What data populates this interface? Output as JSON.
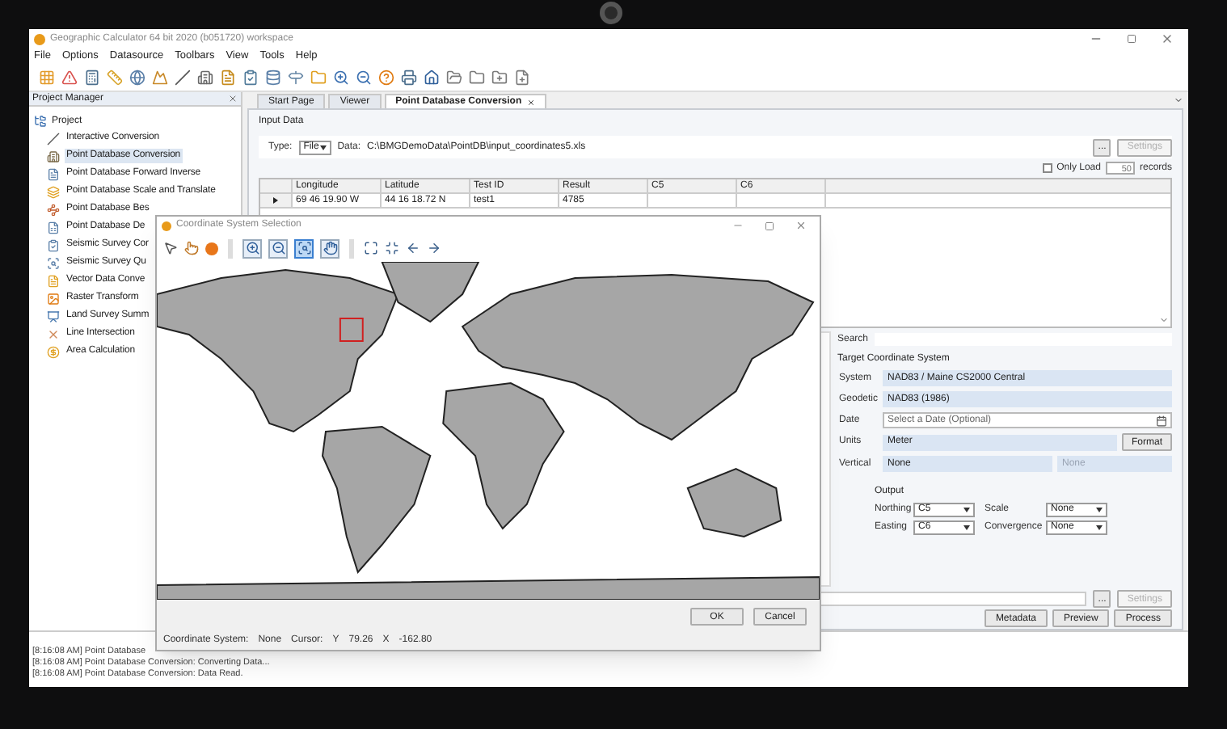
{
  "window": {
    "title": "Geographic Calculator 64 bit 2020 (b051720) workspace"
  },
  "menu": [
    "File",
    "Options",
    "Datasource",
    "Toolbars",
    "View",
    "Tools",
    "Help"
  ],
  "project_manager": {
    "title": "Project Manager",
    "root": {
      "label": "Project",
      "expanded": true,
      "children": [
        {
          "label": "Interactive Conversion",
          "selected": false
        },
        {
          "label": "Point Database Conversion",
          "selected": true
        },
        {
          "label": "Point Database Forward Inverse",
          "selected": false
        },
        {
          "label": "Point Database Scale and Translate",
          "selected": false
        },
        {
          "label": "Point Database Bes",
          "selected": false
        },
        {
          "label": "Point Database De",
          "selected": false
        },
        {
          "label": "Seismic Survey Cor",
          "selected": false
        },
        {
          "label": "Seismic Survey Qu",
          "selected": false
        },
        {
          "label": "Vector Data Conve",
          "selected": false
        },
        {
          "label": "Raster Transform",
          "selected": false
        },
        {
          "label": "Land Survey Summ",
          "selected": false
        },
        {
          "label": "Line Intersection",
          "selected": false
        },
        {
          "label": "Area Calculation",
          "selected": false
        }
      ]
    }
  },
  "tabs": [
    {
      "label": "Start Page",
      "selected": false,
      "closable": false
    },
    {
      "label": "Viewer",
      "selected": false,
      "closable": false
    },
    {
      "label": "Point Database Conversion",
      "selected": true,
      "closable": true
    }
  ],
  "input_data": {
    "title": "Input Data",
    "type_label": "Type:",
    "type_value": "File",
    "data_label": "Data:",
    "data_value": "C:\\BMGDemoData\\PointDB\\input_coordinates5.xls",
    "browse": "...",
    "settings": {
      "label": "Settings",
      "disabled": true
    },
    "only_load": {
      "label": "Only Load",
      "checked": false
    },
    "records_value": "50",
    "records_label": "records"
  },
  "table": {
    "columns": [
      "Longitude",
      "Latitude",
      "Test ID",
      "Result",
      "C5",
      "C6"
    ],
    "rows": [
      {
        "selected": true,
        "cells": [
          "69 46 19.90 W",
          "44 16 18.72 N",
          "test1",
          "4785",
          "",
          ""
        ]
      }
    ]
  },
  "search": {
    "label": "Search"
  },
  "target": {
    "title": "Target Coordinate System",
    "system_label": "System",
    "system": "NAD83 / Maine CS2000 Central",
    "geodetic_label": "Geodetic",
    "geodetic": "NAD83 (1986)",
    "date_label": "Date",
    "date_placeholder": "Select a Date (Optional)",
    "units_label": "Units",
    "units": "Meter",
    "format": "Format",
    "vertical_label": "Vertical",
    "vertical": "None",
    "vertical_2": {
      "value": "None",
      "disabled": true
    }
  },
  "output": {
    "title": "Output",
    "northing_label": "Northing",
    "northing": "C5",
    "easting_label": "Easting",
    "easting": "C6",
    "scale_label": "Scale",
    "scale": "None",
    "convergence_label": "Convergence",
    "convergence": "None"
  },
  "output_file": {
    "browse": "...",
    "settings": {
      "label": "Settings",
      "disabled": true
    }
  },
  "actions": [
    "Metadata",
    "Preview",
    "Process"
  ],
  "log": [
    "[8:16:08 AM] Point Database",
    "[8:16:08 AM] Point Database Conversion: Converting Data...",
    "[8:16:08 AM] Point Database Conversion: Data Read."
  ],
  "dialog": {
    "title": "Coordinate System Selection",
    "tools": [
      {
        "selected": false
      },
      {
        "selected": false
      },
      {
        "selected": true
      },
      {
        "selected": false
      }
    ],
    "ok": "OK",
    "cancel": "Cancel",
    "status": {
      "cs_label": "Coordinate System:",
      "cs_value": "None",
      "cursor_label": "Cursor:",
      "y_label": "Y",
      "y_value": "79.26",
      "x_label": "X",
      "x_value": "-162.80"
    }
  }
}
